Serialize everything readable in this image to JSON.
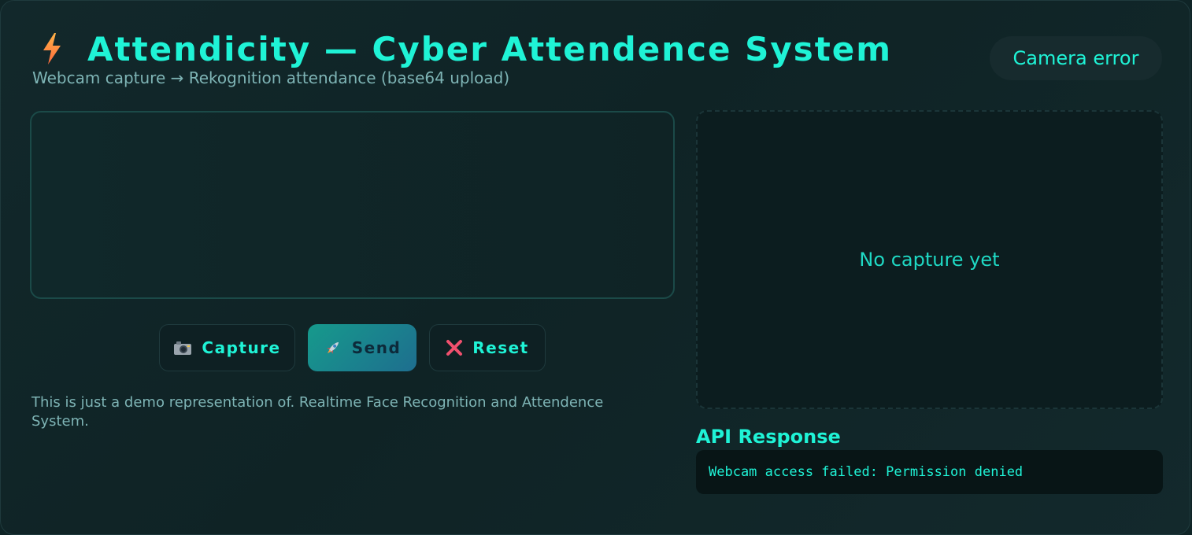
{
  "header": {
    "icon": "lightning-bolt-icon",
    "title": "Attendicity — Cyber Attendence System",
    "subtitle": "Webcam capture → Rekognition attendance (base64 upload)",
    "status": "Camera error"
  },
  "controls": {
    "capture": {
      "icon": "camera-icon",
      "label": "Capture"
    },
    "send": {
      "icon": "rocket-icon",
      "label": "Send"
    },
    "reset": {
      "icon": "cross-mark-icon",
      "label": "Reset"
    }
  },
  "note": "This is just a demo representation of. Realtime Face Recognition and Attendence System.",
  "preview": {
    "placeholder": "No capture yet"
  },
  "api": {
    "heading": "API Response",
    "response": "Webcam access failed: Permission denied"
  },
  "colors": {
    "accent": "#1ff3d6",
    "muted_text": "#7eb4b5",
    "background": "#0f2426",
    "send_gradient_start": "#169a8c",
    "send_gradient_end": "#1e6e8f",
    "reset_icon": "#f0506e"
  }
}
